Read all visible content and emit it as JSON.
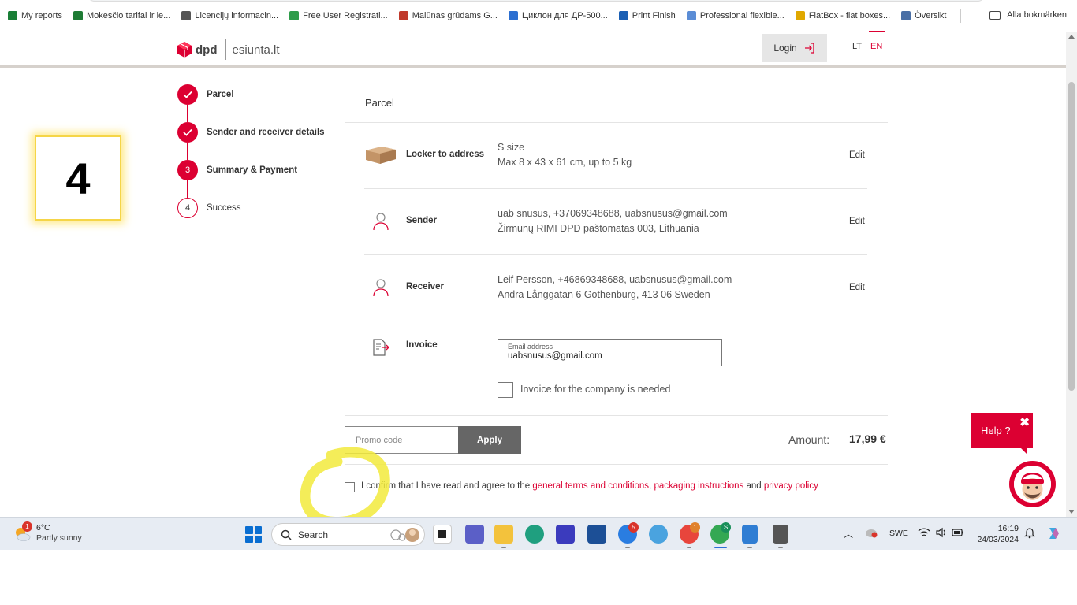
{
  "bookmarks": [
    {
      "label": "My reports",
      "icon": "ko-logo-icon",
      "color": "#1a7f37"
    },
    {
      "label": "Mokesčio tarifai ir le...",
      "icon": "vmi-logo-icon",
      "color": "#1e7b34"
    },
    {
      "label": "Licencijų informacin...",
      "icon": "globe-icon",
      "color": "#555555"
    },
    {
      "label": "Free User Registrati...",
      "icon": "link-icon",
      "color": "#2e9c4a"
    },
    {
      "label": "Malūnas grūdams G...",
      "icon": "tgp-logo-icon",
      "color": "#c0392b"
    },
    {
      "label": "Циклон для ДР-500...",
      "icon": "butterfly-icon",
      "color": "#2c6fd1"
    },
    {
      "label": "Print Finish",
      "icon": "print-finish-icon",
      "color": "#1a5fb4"
    },
    {
      "label": "Professional flexible...",
      "icon": "wave-icon",
      "color": "#5b8dd6"
    },
    {
      "label": "FlatBox - flat boxes...",
      "icon": "flatbox-icon",
      "color": "#e0a800"
    },
    {
      "label": "Översikt",
      "icon": "overview-icon",
      "color": "#4a6fa5"
    }
  ],
  "bookmarks_all": "Alla bokmärken",
  "header": {
    "brand": "dpd",
    "site": "esiunta.lt",
    "login": "Login",
    "lang_lt": "LT",
    "lang_en": "EN",
    "brand_color": "#dc0032"
  },
  "step_badge": "4",
  "steps": [
    {
      "num": "",
      "label": "Parcel",
      "state": "done"
    },
    {
      "num": "",
      "label": "Sender and receiver details",
      "state": "done"
    },
    {
      "num": "3",
      "label": "Summary & Payment",
      "state": "active"
    },
    {
      "num": "4",
      "label": "Success",
      "state": "todo"
    }
  ],
  "summary": {
    "title": "Parcel",
    "parcel": {
      "label": "Locker to address",
      "line1": "S size",
      "line2": "Max 8 x 43 x 61 cm, up to 5 kg",
      "edit": "Edit"
    },
    "sender": {
      "label": "Sender",
      "line1": "uab snusus, +37069348688, uabsnusus@gmail.com",
      "line2": "Žirmūnų RIMI DPD paštomatas 003, Lithuania",
      "edit": "Edit"
    },
    "receiver": {
      "label": "Receiver",
      "line1": "Leif Persson, +46869348688, uabsnusus@gmail.com",
      "line2": "Andra Långgatan 6 Gothenburg, 413 06 Sweden",
      "edit": "Edit"
    },
    "invoice": {
      "label": "Invoice",
      "email_label": "Email address",
      "email_value": "uabsnusus@gmail.com",
      "company_label": "Invoice for the company is needed"
    }
  },
  "promo": {
    "placeholder": "Promo code",
    "apply": "Apply"
  },
  "amount": {
    "label": "Amount:",
    "value": "17,99 €"
  },
  "terms": {
    "prefix": "I confirm that I have read and agree to the",
    "link1": "general terms and conditions",
    "comma": ",",
    "link2": "packaging instructions",
    "and": "and",
    "link3": "privacy policy"
  },
  "help": {
    "label": "Help ?",
    "close": "✖"
  },
  "taskbar": {
    "weather_temp": "6°C",
    "weather_desc": "Partly sunny",
    "weather_badge": "1",
    "search": "Search",
    "mail_badge": "5",
    "chrome_badge": "1",
    "chrome2_badge": "S",
    "lang": "SWE",
    "time": "16:19",
    "date": "24/03/2024"
  }
}
